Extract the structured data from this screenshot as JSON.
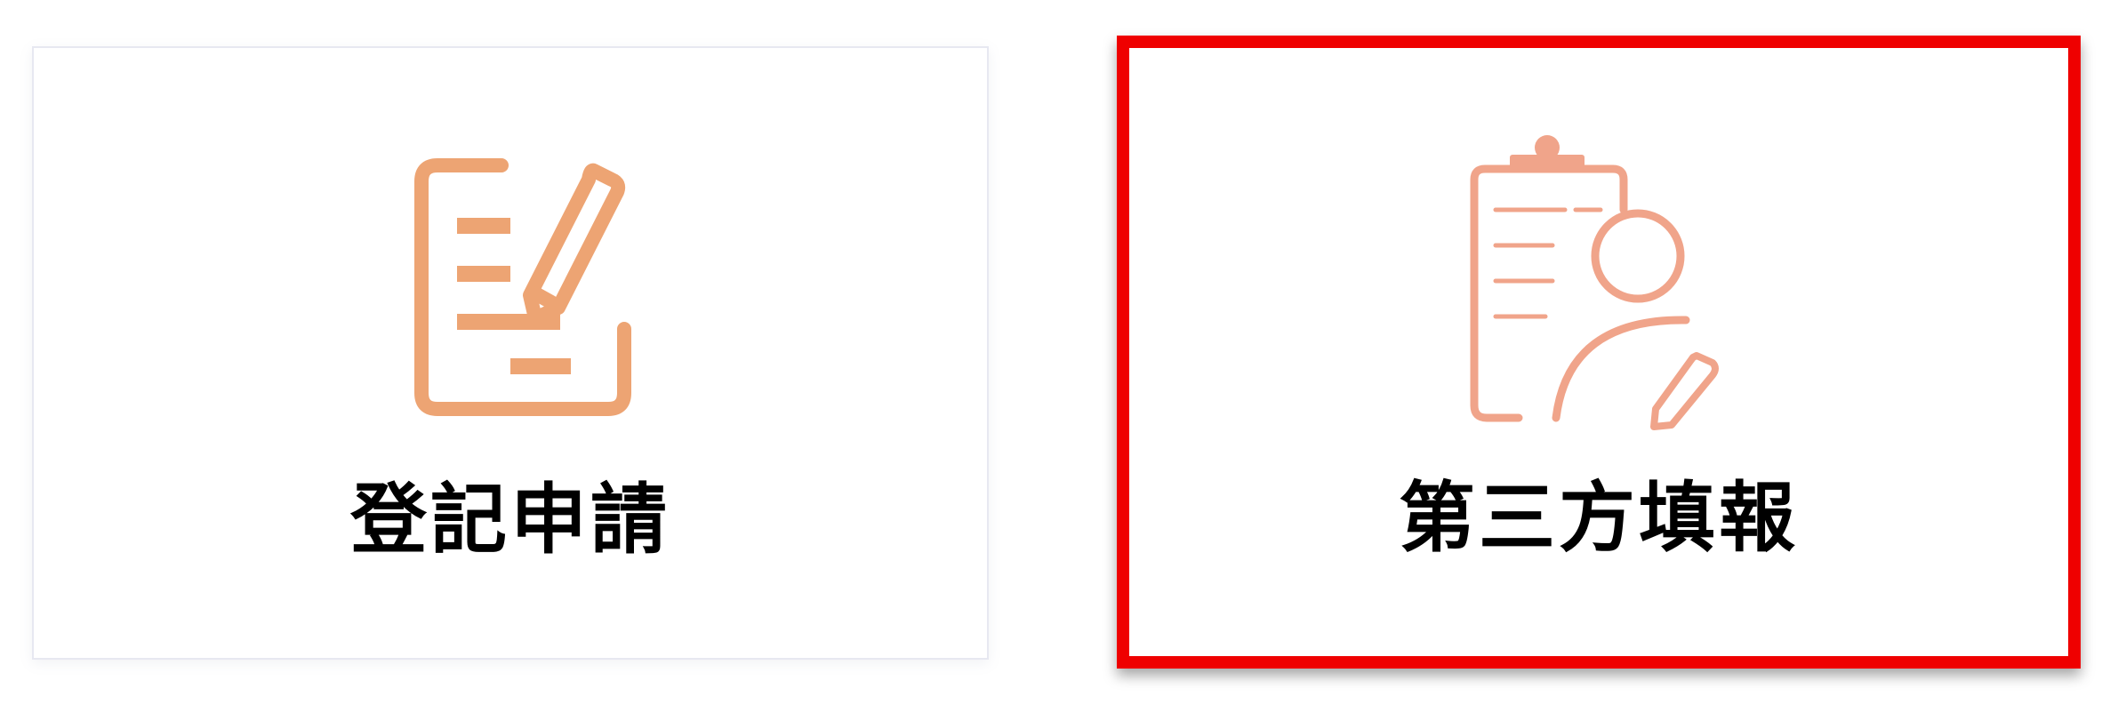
{
  "cards": [
    {
      "label": "登記申請",
      "icon": "document-edit-icon",
      "highlighted": false
    },
    {
      "label": "第三方填報",
      "icon": "clipboard-person-edit-icon",
      "highlighted": true
    }
  ],
  "colors": {
    "icon_apply": "#eda473",
    "icon_third": "#f0a48a",
    "label_text": "#111111",
    "card_border": "#e7e8f1",
    "highlight_border": "#ef0000",
    "background": "#ffffff"
  }
}
